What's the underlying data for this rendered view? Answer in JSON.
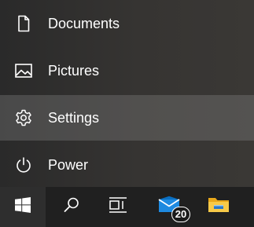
{
  "start_menu": {
    "items": [
      {
        "label": "Documents",
        "icon": "document-icon"
      },
      {
        "label": "Pictures",
        "icon": "pictures-icon"
      },
      {
        "label": "Settings",
        "icon": "gear-icon",
        "highlighted": true
      },
      {
        "label": "Power",
        "icon": "power-icon"
      }
    ]
  },
  "taskbar": {
    "buttons": [
      {
        "icon": "windows-logo-icon"
      },
      {
        "icon": "search-icon"
      },
      {
        "icon": "task-view-icon"
      },
      {
        "icon": "mail-icon",
        "badge": "20"
      },
      {
        "icon": "file-explorer-icon"
      }
    ]
  },
  "colors": {
    "menu_bg": "#2a2a2a",
    "hover_bg": "#5a5856",
    "taskbar_bg": "#202020",
    "mail_blue": "#0a7ad6",
    "folder_yellow": "#f2b92b"
  }
}
